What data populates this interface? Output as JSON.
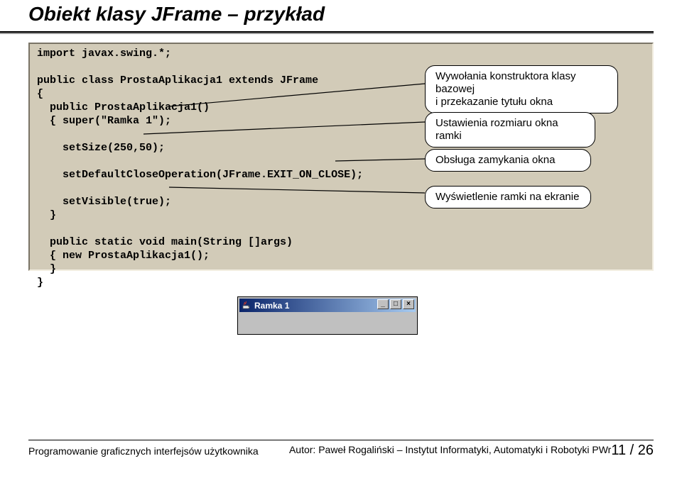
{
  "title": "Obiekt klasy JFrame – przykład",
  "code": {
    "l1": "import javax.swing.*;",
    "l2": "public class ProstaAplikacja1 extends JFrame",
    "l3": "{",
    "l4": "  public ProstaAplikacja1()",
    "l5": "  { super(\"Ramka 1\");",
    "l6": "    setSize(250,50);",
    "l7": "    setDefaultCloseOperation(JFrame.EXIT_ON_CLOSE);",
    "l8": "    setVisible(true);",
    "l9": "  }",
    "l10": "  public static void main(String []args)",
    "l11": "  { new ProstaAplikacja1();",
    "l12": "  }",
    "l13": "}"
  },
  "callouts": {
    "c1a": "Wywołania konstruktora klasy  bazowej",
    "c1b": "i przekazanie tytułu okna",
    "c2": "Ustawienia rozmiaru okna ramki",
    "c3": "Obsługa zamykania okna",
    "c4": "Wyświetlenie ramki na ekranie"
  },
  "window": {
    "title": "Ramka 1",
    "minimize": "_",
    "maximize": "□",
    "close": "×"
  },
  "footer": {
    "left": "Programowanie graficznych interfejsów użytkownika",
    "right_prefix": "Autor: Paweł Rogaliński – Instytut Informatyki, Automatyki i Robotyki PWr",
    "page": "11 / 26"
  }
}
